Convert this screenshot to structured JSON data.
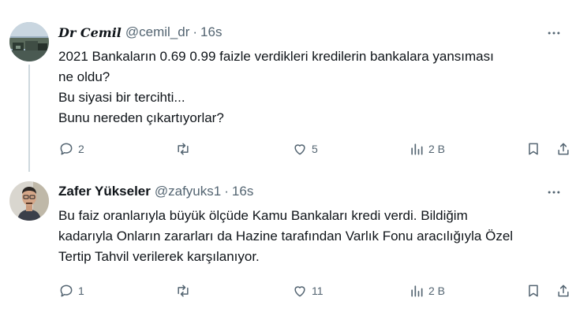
{
  "tweets": [
    {
      "display_name": "Dr Cemil",
      "handle": "@cemil_dr",
      "separator": "·",
      "time": "16s",
      "lines": [
        "2021 Bankaların 0.69 0.99 faizle verdikleri kredilerin bankalara yansıması",
        "ne oldu?",
        "Bu siyasi bir tercihti...",
        "Bunu nereden çıkartıyorlar?"
      ],
      "replies": "2",
      "retweets": "",
      "likes": "5",
      "views": "2 B"
    },
    {
      "display_name": "Zafer Yükseler",
      "handle": "@zafyuks1",
      "separator": "·",
      "time": "16s",
      "lines": [
        "Bu faiz oranlarıyla büyük ölçüde Kamu Bankaları kredi verdi. Bildiğim",
        "kadarıyla Onların zararları da Hazine tarafından Varlık Fonu aracılığıyla Özel",
        "Tertip Tahvil verilerek karşılanıyor."
      ],
      "replies": "1",
      "retweets": "",
      "likes": "11",
      "views": "2 B"
    }
  ],
  "icons": {
    "reply": "reply-icon",
    "retweet": "retweet-icon",
    "like": "heart-icon",
    "views": "views-icon",
    "bookmark": "bookmark-icon",
    "share": "share-icon",
    "more": "more-icon"
  },
  "colors": {
    "text": "#0f1419",
    "secondary": "#536471",
    "thread_line": "#cfd9de"
  }
}
